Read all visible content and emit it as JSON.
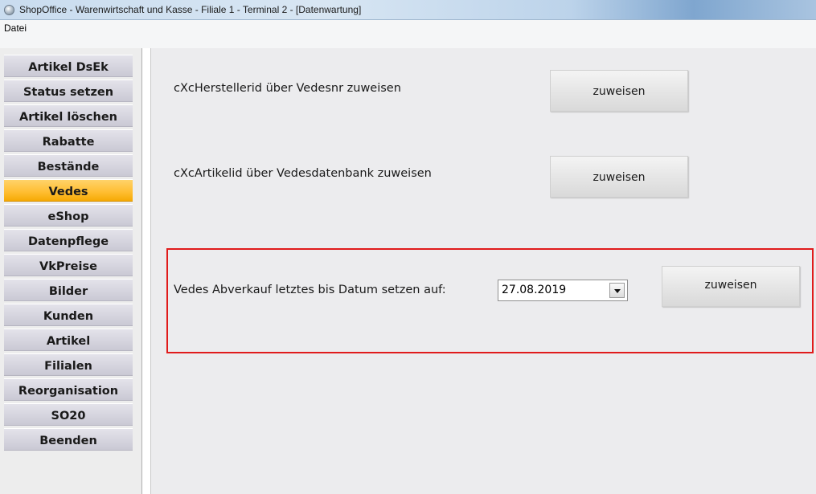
{
  "window": {
    "title": "ShopOffice - Warenwirtschaft und Kasse - Filiale 1 - Terminal 2 - [Datenwartung]",
    "icon": "app-orb-icon"
  },
  "menu": {
    "items": [
      "Datei"
    ]
  },
  "sidebar": {
    "items": [
      {
        "label": "Artikel DsEk"
      },
      {
        "label": "Status setzen"
      },
      {
        "label": "Artikel löschen"
      },
      {
        "label": "Rabatte"
      },
      {
        "label": "Bestände"
      },
      {
        "label": "Vedes",
        "active": true
      },
      {
        "label": "eShop"
      },
      {
        "label": "Datenpflege"
      },
      {
        "label": "VkPreise"
      },
      {
        "label": "Bilder"
      },
      {
        "label": "Kunden"
      },
      {
        "label": "Artikel"
      },
      {
        "label": "Filialen"
      },
      {
        "label": "Reorganisation"
      },
      {
        "label": "SO20"
      },
      {
        "label": "Beenden"
      }
    ],
    "active_color": "#ffbe33"
  },
  "main": {
    "rows": [
      {
        "label": "cXcHerstellerid über Vedesnr zuweisen",
        "button": "zuweisen"
      },
      {
        "label": "cXcArtikelid über Vedesdatenbank zuweisen",
        "button": "zuweisen"
      },
      {
        "label": "Vedes Abverkauf letztes bis Datum setzen auf:",
        "button": "zuweisen",
        "date_value": "27.08.2019"
      }
    ],
    "highlight_color": "#e01b1b"
  }
}
